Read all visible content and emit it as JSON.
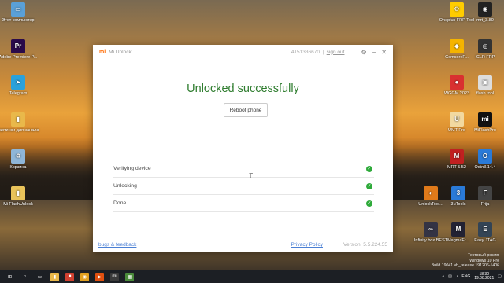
{
  "desktop": {
    "left_icons": [
      {
        "label": "Этот компьютер",
        "icon": "computer-icon",
        "color": "#5aa0d8",
        "glyph": "▭"
      },
      {
        "label": "Adobe Premiere P...",
        "icon": "premiere-icon",
        "color": "#2a0a4a",
        "glyph": "Pr"
      },
      {
        "label": "Telegram",
        "icon": "telegram-icon",
        "color": "#2aa1da",
        "glyph": "➤"
      },
      {
        "label": "картинки для канала",
        "icon": "folder-icon",
        "color": "#e9b84a",
        "glyph": "▮"
      },
      {
        "label": "Корзина",
        "icon": "recycle-bin-icon",
        "color": "#8fb6d8",
        "glyph": "♻"
      },
      {
        "label": "Mi FlashUnlock",
        "icon": "folder-icon",
        "color": "#e9c35a",
        "glyph": "▮"
      }
    ],
    "right_icons": [
      {
        "label": "Oneplus FRP Tool",
        "icon": "frp-tool-icon",
        "color": "#ffcc00",
        "glyph": "⚙"
      },
      {
        "label": "mrt_3.80",
        "icon": "mrt-icon",
        "color": "#222",
        "glyph": "◉"
      },
      {
        "label": "GsmcoreP...",
        "icon": "gsmcore-icon",
        "color": "#f5b400",
        "glyph": "◆"
      },
      {
        "label": "iCLR FRP",
        "icon": "iclr-icon",
        "color": "#333",
        "glyph": "◎"
      },
      {
        "label": "WGGM 2023",
        "icon": "wggm-icon",
        "color": "#d93030",
        "glyph": "●"
      },
      {
        "label": "flash tool",
        "icon": "flash-tool-icon",
        "color": "#ddd",
        "glyph": "▣"
      },
      {
        "label": "UMT Pro",
        "icon": "umt-icon",
        "color": "#f2d9a0",
        "glyph": "U"
      },
      {
        "label": "MiFlashPro",
        "icon": "miflashpro-icon",
        "color": "#111",
        "glyph": "mi"
      },
      {
        "label": "MRT 5.52",
        "icon": "mrt-icon",
        "color": "#c02020",
        "glyph": "M"
      },
      {
        "label": "Odin3.14.4",
        "icon": "odin-icon",
        "color": "#2a7ad8",
        "glyph": "O"
      },
      {
        "label": "UnlockTool...",
        "icon": "unlocktool-icon",
        "color": "#e07a1a",
        "glyph": "◐"
      },
      {
        "label": "3uTools",
        "icon": "3utools-icon",
        "color": "#2a7ad8",
        "glyph": "3"
      },
      {
        "label": "Frija",
        "icon": "frija-icon",
        "color": "#444",
        "glyph": "F"
      },
      {
        "label": "Infinity box BEST",
        "icon": "infinity-icon",
        "color": "#334",
        "glyph": "∞"
      },
      {
        "label": "MagmaFr...",
        "icon": "magma-icon",
        "color": "#223",
        "glyph": "M"
      },
      {
        "label": "Easy JTAG",
        "icon": "easyjtag-icon",
        "color": "#345",
        "glyph": "E"
      }
    ]
  },
  "window": {
    "app_name": "Mi Unlock",
    "logo": "mi",
    "phone": "4151336670",
    "separator": "|",
    "signout": "sign out",
    "settings_icon": "gear-icon",
    "minimize_icon": "minimize-icon",
    "close_icon": "close-icon",
    "title": "Unlocked successfully",
    "reboot_label": "Reboot phone",
    "steps": [
      {
        "label": "Verifying device"
      },
      {
        "label": "Unlocking"
      },
      {
        "label": "Done"
      }
    ],
    "check_glyph": "✓",
    "bugs_link": "bugs & feedback",
    "privacy_link": "Privacy Policy",
    "version": "Version: 5.5.224.55"
  },
  "taskbar": {
    "apps": [
      {
        "icon": "start-icon",
        "color": "#1c1f24",
        "glyph": "⊞"
      },
      {
        "icon": "search-icon",
        "color": "#1c1f24",
        "glyph": "○"
      },
      {
        "icon": "task-view-icon",
        "color": "#1c1f24",
        "glyph": "▭"
      },
      {
        "icon": "explorer-icon",
        "color": "#e9b84a",
        "glyph": "▮"
      },
      {
        "icon": "app-red-icon",
        "color": "#d04030",
        "glyph": "■"
      },
      {
        "icon": "chrome-icon",
        "color": "#e0a020",
        "glyph": "◉"
      },
      {
        "icon": "media-icon",
        "color": "#e05010",
        "glyph": "▶"
      },
      {
        "icon": "mi-unlock-icon",
        "color": "#3a3a3a",
        "glyph": "mi"
      },
      {
        "icon": "app-green-icon",
        "color": "#4a8a3a",
        "glyph": "▦"
      }
    ],
    "lang": "ENG",
    "time": "18:30",
    "date": "19.08.2021"
  },
  "watermark": {
    "line1": "Тестовый режим",
    "line2": "Windows 10 Pro",
    "line3": "Build 19041.vb_release.191206-1406"
  }
}
